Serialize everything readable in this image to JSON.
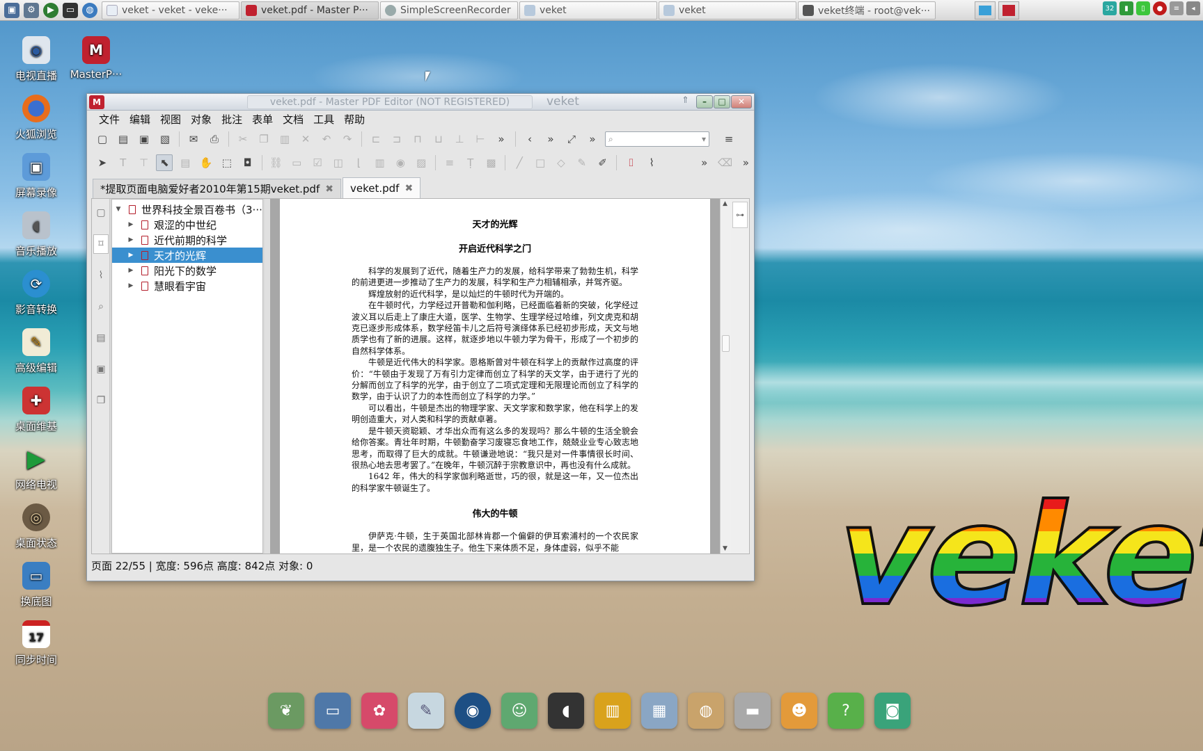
{
  "taskbar": {
    "tasks": [
      {
        "label": "veket - veket - veke···",
        "active": false
      },
      {
        "label": "veket.pdf - Master P···",
        "active": true
      },
      {
        "label": "SimpleScreenRecorder",
        "active": false
      },
      {
        "label": "veket",
        "active": false
      },
      {
        "label": "veket",
        "active": false
      },
      {
        "label": "veket终端 - root@vek···",
        "active": false
      }
    ],
    "tray_badge": "32"
  },
  "desktop": {
    "icons": [
      {
        "label": "电视直播",
        "icon": "tv-icon"
      },
      {
        "label": "MasterP···",
        "icon": "pdf-icon"
      },
      {
        "label": "火狐浏览",
        "icon": "firefox-icon"
      },
      {
        "label": "屏幕录像",
        "icon": "screen-record-icon"
      },
      {
        "label": "音乐播放",
        "icon": "speaker-icon"
      },
      {
        "label": "影音转换",
        "icon": "media-convert-icon"
      },
      {
        "label": "高级编辑",
        "icon": "editor-icon"
      },
      {
        "label": "桌面维基",
        "icon": "wiki-icon"
      },
      {
        "label": "网络电视",
        "icon": "play-icon"
      },
      {
        "label": "桌面状态",
        "icon": "status-icon"
      },
      {
        "label": "换底图",
        "icon": "wallpaper-icon"
      },
      {
        "label": "同步时间",
        "icon": "calendar-icon"
      }
    ],
    "calendar_day": "17",
    "logo_text": "veket"
  },
  "window": {
    "title": "veket.pdf - Master PDF Editor (NOT REGISTERED)",
    "host": "veket",
    "menu": [
      "文件",
      "编辑",
      "视图",
      "对象",
      "批注",
      "表单",
      "文档",
      "工具",
      "帮助"
    ],
    "tabs": [
      {
        "label": "*提取页面电脑爱好者2010年第15期veket.pdf",
        "active": false
      },
      {
        "label": "veket.pdf",
        "active": true
      }
    ],
    "bookmarks": [
      {
        "label": "世界科技全景百卷书（3···",
        "level": 0,
        "expanded": true
      },
      {
        "label": "艰涩的中世纪",
        "level": 1
      },
      {
        "label": "近代前期的科学",
        "level": 1
      },
      {
        "label": "天才的光辉",
        "level": 1,
        "selected": true
      },
      {
        "label": "阳光下的数学",
        "level": 1
      },
      {
        "label": "慧眼看宇宙",
        "level": 1
      }
    ],
    "status": "页面 22/55 | 宽度: 596点 高度: 842点 对象: 0"
  },
  "document": {
    "heading1": "天才的光辉",
    "heading2": "开启近代科学之门",
    "paragraphs": [
      "科学的发展到了近代，随着生产力的发展，给科学带来了勃勃生机，科学的前进更进一步推动了生产力的发展，科学和生产力相辅相承，并驾齐驱。",
      "辉煌放射的近代科学，是以灿烂的牛顿时代为开端的。",
      "在牛顿时代，力学经过开普勒和伽利略，已经面临着新的突破，化学经过波义耳以后走上了康庄大道，医学、生物学、生理学经过哈维，列文虎克和胡克已逐步形成体系，数学经笛卡儿之后符号演绎体系已经初步形成，天文与地质学也有了新的进展。这样，就逐步地以牛顿力学为骨干，形成了一个初步的自然科学体系。",
      "牛顿是近代伟大的科学家。恩格斯曾对牛顿在科学上的贡献作过高度的评价：“牛顿由于发现了万有引力定律而创立了科学的天文学，由于进行了光的分解而创立了科学的光学，由于创立了二项式定理和无限理论而创立了科学的数学，由于认识了力的本性而创立了科学的力学。”",
      "可以看出，牛顿是杰出的物理学家、天文学家和数学家，他在科学上的发明创造重大，对人类和科学的贡献卓著。",
      "是牛顿天资聪颖、才华出众而有这么多的发现吗？那么牛顿的生活全貌会给你答案。青壮年时期，牛顿勤奋学习废寝忘食地工作，兢兢业业专心致志地思考，而取得了巨大的成就。牛顿谦逊地说：“我只是对一件事情很长时间、很热心地去思考罢了。”在晚年，牛顿沉醉于宗教意识中，再也没有什么成就。",
      "1642 年，伟大的科学家伽利略逝世，巧的很，就是这一年，又一位杰出的科学家牛顿诞生了。"
    ],
    "heading3": "伟大的牛顿",
    "paragraph_last": "伊萨克·牛顿，生于英国北部林肯郡一个偏僻的伊耳索浦村的一个农民家里，是一个农民的遗腹独生子。他生下来体质不足，身体虚弱，似乎不能"
  }
}
